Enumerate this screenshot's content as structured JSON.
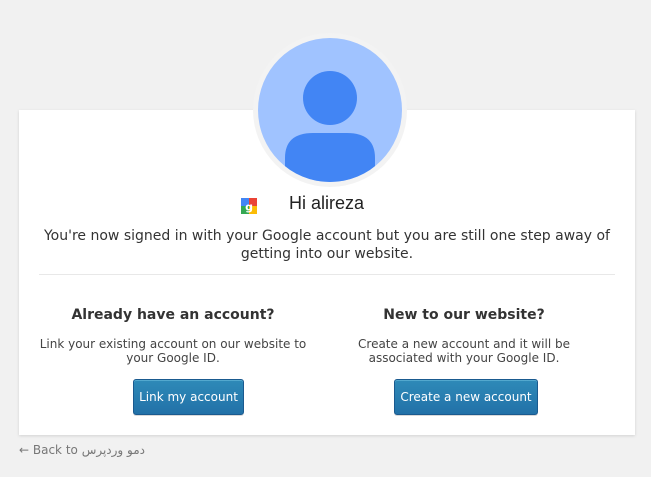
{
  "greeting": {
    "text": "Hi alireza",
    "provider_icon": "google-plus-icon"
  },
  "intro": "You're now signed in with your Google account but you are still one step away of getting into our website.",
  "existing": {
    "title": "Already have an account?",
    "description": "Link your existing account on our website to your Google ID.",
    "button_label": "Link my account"
  },
  "new_account": {
    "title": "New to our website?",
    "description": "Create a new account and it will be associated with your Google ID.",
    "button_label": "Create a new account"
  },
  "footer": {
    "back_link": "← Back to دمو وردپرس"
  },
  "colors": {
    "background": "#f1f1f1",
    "card": "#ffffff",
    "avatar_bg": "#a0c3ff",
    "avatar_figure": "#4285f4",
    "button": "#2271b1"
  }
}
